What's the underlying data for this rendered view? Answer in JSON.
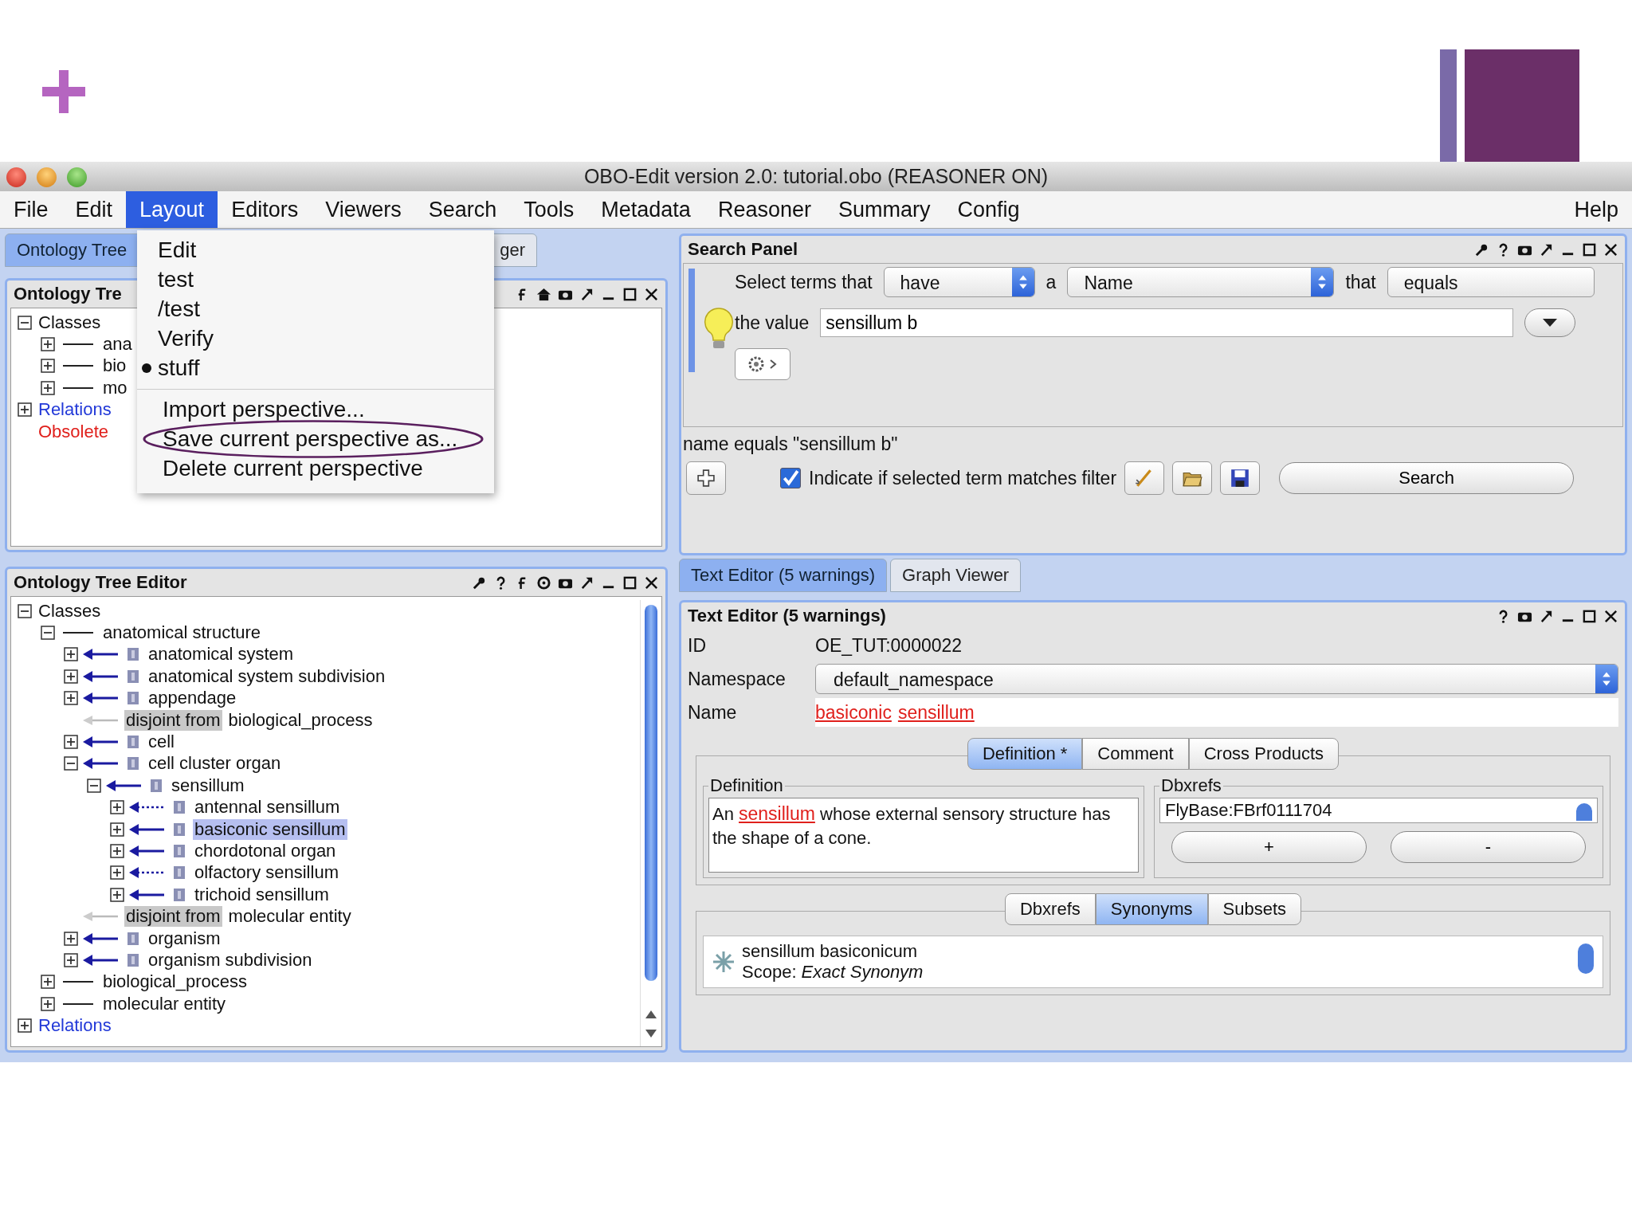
{
  "window": {
    "title": "OBO-Edit version 2.0: tutorial.obo (REASONER ON)"
  },
  "menu_bar": [
    {
      "label": "File",
      "selected": false
    },
    {
      "label": "Edit",
      "selected": false
    },
    {
      "label": "Layout",
      "selected": true
    },
    {
      "label": "Editors",
      "selected": false
    },
    {
      "label": "Viewers",
      "selected": false
    },
    {
      "label": "Search",
      "selected": false
    },
    {
      "label": "Tools",
      "selected": false
    },
    {
      "label": "Metadata",
      "selected": false
    },
    {
      "label": "Reasoner",
      "selected": false
    },
    {
      "label": "Summary",
      "selected": false
    },
    {
      "label": "Config",
      "selected": false
    },
    {
      "label": "Help",
      "selected": false
    }
  ],
  "layout_menu": {
    "perspectives": [
      {
        "label": "Edit",
        "current": false
      },
      {
        "label": "test",
        "current": false
      },
      {
        "label": "/test",
        "current": false
      },
      {
        "label": "Verify",
        "current": false
      },
      {
        "label": "stuff",
        "current": true
      }
    ],
    "actions": [
      {
        "label": "Import perspective...",
        "highlighted": false
      },
      {
        "label": "Save current perspective as...",
        "highlighted": true
      },
      {
        "label": "Delete current perspective",
        "highlighted": false
      }
    ]
  },
  "left_tabs": [
    {
      "label": "Ontology Tree",
      "selected": true
    },
    {
      "label": "ger",
      "selected": false
    }
  ],
  "tree_panel_top": {
    "title": "Ontology Tre",
    "tree": [
      {
        "label": "Classes",
        "kind": "root",
        "expanded": true,
        "children": [
          {
            "label": "ana",
            "kind": "top_class",
            "expanded": false
          },
          {
            "label": "bio",
            "kind": "top_class",
            "expanded": false
          },
          {
            "label": "mo",
            "kind": "top_class",
            "expanded": false
          }
        ]
      },
      {
        "label": "Relations",
        "kind": "relations",
        "expanded": false
      },
      {
        "label": "Obsolete",
        "kind": "obsolete"
      }
    ]
  },
  "tree_panel_bottom": {
    "title": "Ontology Tree Editor",
    "tree": [
      {
        "label": "Classes",
        "kind": "root",
        "expanded": true,
        "children": [
          {
            "label": "anatomical structure",
            "kind": "top_class",
            "expanded": true,
            "selected": false,
            "children": [
              {
                "label": "anatomical system",
                "kind": "is_a",
                "expanded": false,
                "selected": false
              },
              {
                "label": "anatomical system subdivision",
                "kind": "is_a",
                "expanded": false,
                "selected": false
              },
              {
                "label": "appendage",
                "kind": "is_a",
                "expanded": false,
                "selected": false
              },
              {
                "label": "biological_process",
                "kind": "disjoint",
                "tag": "disjoint from"
              },
              {
                "label": "cell",
                "kind": "is_a",
                "expanded": false,
                "selected": false
              },
              {
                "label": "cell cluster organ",
                "kind": "is_a",
                "expanded": true,
                "selected": false,
                "children": [
                  {
                    "label": "sensillum",
                    "kind": "is_a",
                    "expanded": true,
                    "selected": false,
                    "children": [
                      {
                        "label": "antennal sensillum",
                        "kind": "is_a_dotted",
                        "expanded": false,
                        "selected": false
                      },
                      {
                        "label": "basiconic sensillum",
                        "kind": "is_a",
                        "expanded": false,
                        "selected": true
                      },
                      {
                        "label": "chordotonal organ",
                        "kind": "is_a",
                        "expanded": false,
                        "selected": false
                      },
                      {
                        "label": "olfactory sensillum",
                        "kind": "is_a_dotted",
                        "expanded": false,
                        "selected": false
                      },
                      {
                        "label": "trichoid sensillum",
                        "kind": "is_a",
                        "expanded": false,
                        "selected": false
                      }
                    ]
                  }
                ]
              },
              {
                "label": "molecular entity",
                "kind": "disjoint",
                "tag": "disjoint from"
              },
              {
                "label": "organism",
                "kind": "is_a",
                "expanded": false,
                "selected": false
              },
              {
                "label": "organism subdivision",
                "kind": "is_a",
                "expanded": false,
                "selected": false
              }
            ]
          },
          {
            "label": "biological_process",
            "kind": "top_class",
            "expanded": false,
            "selected": false
          },
          {
            "label": "molecular entity",
            "kind": "top_class",
            "expanded": false,
            "selected": false
          }
        ]
      },
      {
        "label": "Relations",
        "kind": "relations",
        "expanded": false
      }
    ]
  },
  "search_panel": {
    "title": "Search Panel",
    "select_label": "Select terms that",
    "quantifier": "have",
    "a_label": "a",
    "field": "Name",
    "that_label": "that",
    "comparison": "equals",
    "value_label": "the value",
    "value": "sensillum b",
    "filter_text": "name equals \"sensillum b\"",
    "indicate": {
      "label": "Indicate if selected term matches filter",
      "checked": true
    },
    "search_button": "Search"
  },
  "editor_tabs": [
    {
      "label": "Text Editor (5 warnings)",
      "selected": true
    },
    {
      "label": "Graph Viewer",
      "selected": false
    }
  ],
  "text_editor": {
    "title": "Text Editor (5 warnings)",
    "id_label": "ID",
    "id": "OE_TUT:0000022",
    "namespace_label": "Namespace",
    "namespace": "default_namespace",
    "name_label": "Name",
    "name_words": [
      "basiconic",
      "sensillum"
    ],
    "sub_tabs": [
      {
        "label": "Definition *",
        "selected": true
      },
      {
        "label": "Comment",
        "selected": false
      },
      {
        "label": "Cross Products",
        "selected": false
      }
    ],
    "definition_title": "Definition",
    "definition": {
      "before": "An",
      "link": "sensillum",
      "after": "whose external sensory structure has the shape of a cone."
    },
    "dbxrefs_title": "Dbxrefs",
    "dbxrefs": [
      "FlyBase:FBrf0111704"
    ],
    "add_button": "+",
    "remove_button": "-",
    "lower_tabs": [
      {
        "label": "Dbxrefs",
        "selected": false
      },
      {
        "label": "Synonyms",
        "selected": true
      },
      {
        "label": "Subsets",
        "selected": false
      }
    ],
    "synonyms": [
      {
        "text": "sensillum basiconicum",
        "scope": "Scope: *Exact Synonym*"
      }
    ]
  }
}
